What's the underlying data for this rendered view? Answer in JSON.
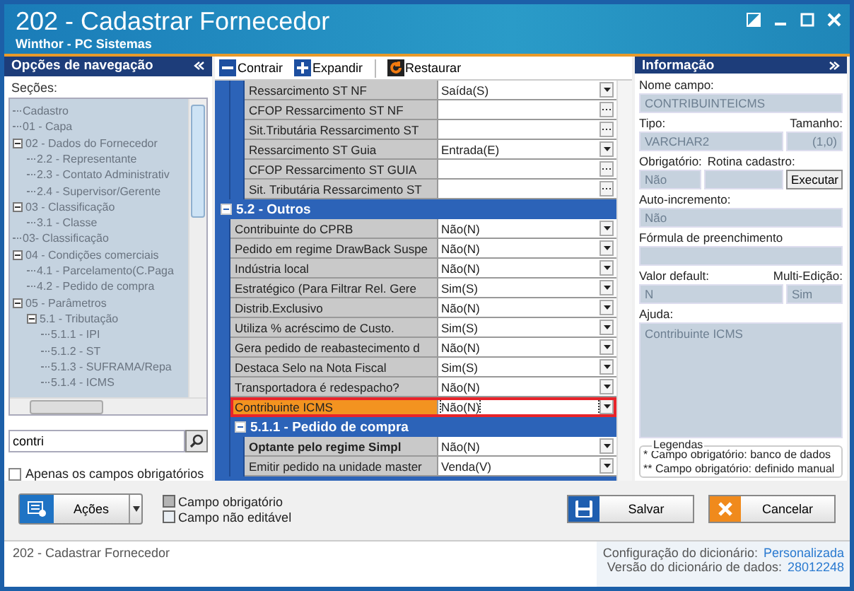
{
  "window": {
    "title": "202 - Cadastrar  Fornecedor",
    "subtitle": "Winthor - PC Sistemas"
  },
  "nav": {
    "title": "Opções de navegação",
    "sections_label": "Seções:",
    "tree": [
      {
        "label": "Cadastro"
      },
      {
        "label": "01 - Capa"
      },
      {
        "label": "02 - Dados do Fornecedor",
        "expanded": true,
        "children": [
          {
            "label": "2.2 - Representante"
          },
          {
            "label": "2.3 - Contato Administrativ"
          },
          {
            "label": "2.4 - Supervisor/Gerente"
          }
        ]
      },
      {
        "label": "03 - Classificação",
        "expanded": true,
        "children": [
          {
            "label": "3.1 - Classe"
          }
        ]
      },
      {
        "label": "03- Classificação"
      },
      {
        "label": "04 - Condições comerciais",
        "expanded": true,
        "children": [
          {
            "label": "4.1 - Parcelamento(C.Paga"
          },
          {
            "label": "4.2 - Pedido de compra"
          }
        ]
      },
      {
        "label": "05 - Parâmetros",
        "expanded": true,
        "children": [
          {
            "label": "5.1 - Tributação",
            "expanded": true,
            "children": [
              {
                "label": "5.1.1 - IPI"
              },
              {
                "label": "5.1.2 - ST"
              },
              {
                "label": "5.1.3 - SUFRAMA/Repa"
              },
              {
                "label": "5.1.4 - ICMS"
              }
            ]
          }
        ]
      }
    ],
    "search": {
      "value": "contri"
    },
    "only_required": {
      "label": "Apenas os campos obrigatórios",
      "checked": false
    }
  },
  "toolbar": [
    {
      "label": "Contrair",
      "kind": "collapse"
    },
    {
      "label": "Expandir",
      "kind": "expand"
    },
    {
      "label": "Restaurar",
      "kind": "restore"
    }
  ],
  "grid": {
    "rows": [
      {
        "label": "Ressarcimento ST NF",
        "value": "Saída(S)",
        "kind": "dropdown",
        "selected": false,
        "required": false
      },
      {
        "label": "CFOP Ressarcimento ST NF",
        "kind": "ellipsis",
        "selected": false,
        "required": false
      },
      {
        "label": "Sit.Tributária Ressarcimento ST",
        "kind": "ellipsis",
        "selected": false,
        "required": false
      },
      {
        "label": "Ressarcimento ST Guia",
        "value": "Entrada(E)",
        "kind": "dropdown",
        "selected": false,
        "required": false
      },
      {
        "label": "CFOP Ressarcimento ST GUIA",
        "kind": "ellipsis",
        "selected": false,
        "required": false
      },
      {
        "label": "Sit. Tributária Ressarcimento ST",
        "kind": "ellipsis",
        "selected": false,
        "required": false
      }
    ],
    "sections": [
      {
        "title": "5.2 - Outros",
        "expanded": true,
        "rows": [
          {
            "label": "Contribuinte do CPRB",
            "value": "Não(N)",
            "kind": "dropdown",
            "selected": false,
            "required": false
          },
          {
            "label": "Pedido em regime DrawBack Suspe",
            "value": "Não(N)",
            "kind": "dropdown",
            "selected": false,
            "required": false
          },
          {
            "label": "Indústria local",
            "value": "Não(N)",
            "kind": "dropdown",
            "selected": false,
            "required": false
          },
          {
            "label": "Estratégico  (Para Filtrar Rel. Gere",
            "value": "Sim(S)",
            "kind": "dropdown",
            "selected": false,
            "required": false
          },
          {
            "label": "Distrib.Exclusivo",
            "value": "Não(N)",
            "kind": "dropdown",
            "selected": false,
            "required": false
          },
          {
            "label": "Utiliza % acréscimo de Custo.",
            "value": "Sim(S)",
            "kind": "dropdown",
            "selected": false,
            "required": false
          },
          {
            "label": "Gera pedido de reabastecimento d",
            "value": "Não(N)",
            "kind": "dropdown",
            "selected": false,
            "required": false
          },
          {
            "label": "Destaca Selo na Nota Fiscal",
            "value": "Sim(S)",
            "kind": "dropdown",
            "selected": false,
            "required": false
          },
          {
            "label": "Transportadora é redespacho?",
            "value": "Não(N)",
            "kind": "dropdown",
            "selected": false,
            "required": false
          },
          {
            "label": "Contribuinte ICMS",
            "value": "Não(N)",
            "kind": "dropdown",
            "selected": true,
            "required": false
          }
        ],
        "children": [
          {
            "title": "5.1.1 - Pedido de compra",
            "expanded": true,
            "rows": [
              {
                "label": "Optante pelo regime Simpl",
                "value": "Não(N)",
                "kind": "dropdown",
                "selected": false,
                "required": true
              },
              {
                "label": "Emitir pedido na unidade master",
                "value": "Venda(V)",
                "kind": "dropdown",
                "selected": false,
                "required": false
              }
            ]
          }
        ]
      }
    ]
  },
  "info": {
    "title": "Informação",
    "name_label": "Nome campo:",
    "name_value": "CONTRIBUINTEICMS",
    "type_label": "Tipo:",
    "type_value": "VARCHAR2",
    "size_label": "Tamanho:",
    "size_value": "(1,0)",
    "required_label": "Obrigatório:",
    "required_value": "Não",
    "routine_label": "Rotina cadastro:",
    "run_button": "Executar",
    "autoinc_label": "Auto-incremento:",
    "autoinc_value": "Não",
    "formula_label": "Fórmula de preenchimento",
    "default_label": "Valor default:",
    "default_value": "N",
    "multi_label": "Multi-Edição:",
    "multi_value": "Sim",
    "help_label": "Ajuda:",
    "help_value": "Contribuinte ICMS",
    "legend_title": "Legendas",
    "legend_lines": [
      "* Campo obrigatório: banco de dados",
      "** Campo obrigatório: definido manual"
    ]
  },
  "actions": {
    "label": "Ações"
  },
  "legend": [
    {
      "label": "Campo obrigatório",
      "kind": "required"
    },
    {
      "label": "Campo não editável",
      "kind": "readonly"
    }
  ],
  "buttons": [
    {
      "label": "Salvar",
      "kind": "save"
    },
    {
      "label": "Cancelar",
      "kind": "cancel"
    }
  ],
  "status": {
    "text": "202 - Cadastrar  Fornecedor",
    "config_label": "Configuração do dicionário:",
    "config_value": "Personalizada",
    "version_label": "Versão do dicionário de dados:",
    "version_value": "28012248"
  }
}
